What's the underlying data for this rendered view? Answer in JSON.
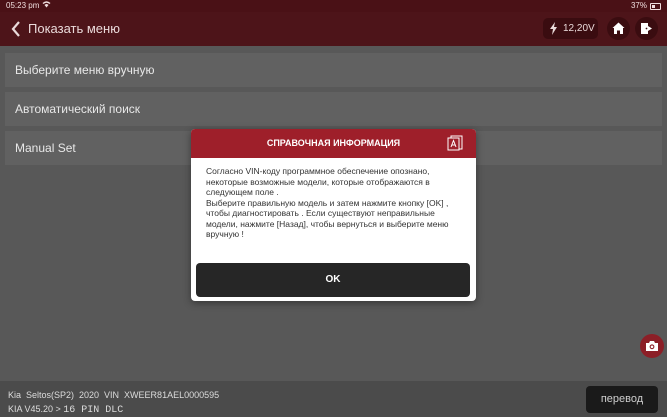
{
  "status_bar": {
    "time": "05:23 pm",
    "battery": "37%"
  },
  "header": {
    "title": "Показать меню",
    "voltage": "12,20V"
  },
  "menu": {
    "items": [
      {
        "label": "Выберите меню вручную"
      },
      {
        "label": "Автоматический поиск"
      },
      {
        "label": "Manual Set"
      }
    ]
  },
  "dialog": {
    "title": "СПРАВОЧНАЯ ИНФОРМАЦИЯ",
    "paragraph1": "Согласно VIN-коду программное обеспечение опознано, некоторые возможные модели, которые отображаются в следующем поле .",
    "paragraph2": "Выберите правильную модель и затем нажмите кнопку [OK] , чтобы диагностировать . Если существуют неправильные модели, нажмите [Назад], чтобы вернуться и выберите меню вручную !",
    "ok_label": "OK"
  },
  "bottom_bar": {
    "vehicle_info": "Kia  Seltos(SP2)  2020  VIN  XWEER81AEL0000595",
    "version": "KIA V45.20 > ",
    "connector": "16 PIN DLC",
    "translate_label": "перевод"
  },
  "colors": {
    "header_bg": "#4d1419",
    "dialog_header": "#9e1f2a",
    "menu_item_bg": "#616161",
    "ok_button_bg": "#262626",
    "camera_button": "#8c1f27"
  }
}
